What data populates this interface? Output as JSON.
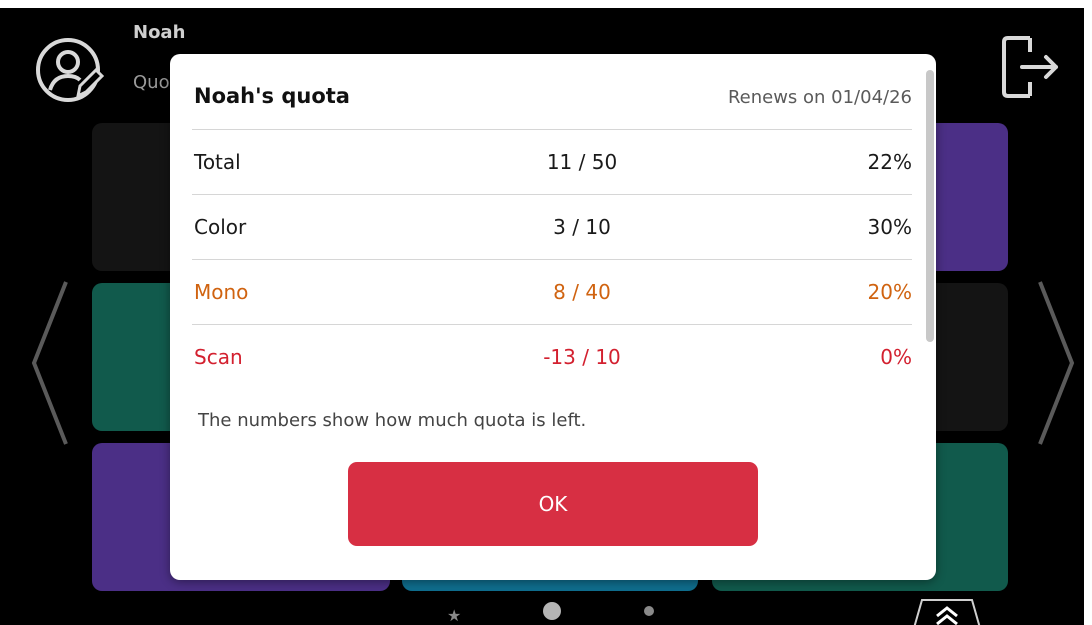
{
  "header": {
    "user_name": "Noah",
    "user_sub": "Quo",
    "avatar_icon": "user-edit-icon",
    "logout_icon": "logout-icon"
  },
  "tiles": {
    "colors": [
      "#141414",
      "#4b2f86",
      "#115a4c",
      "#141414",
      "#4b2f86",
      "#0f6e8e",
      "#115a4c"
    ]
  },
  "modal": {
    "title": "Noah's quota",
    "renew": "Renews on 01/04/26",
    "rows": [
      {
        "label": "Total",
        "value": "11 / 50",
        "percent": "22%"
      },
      {
        "label": "Color",
        "value": "3 / 10",
        "percent": "30%"
      },
      {
        "label": "Mono",
        "value": "8 / 40",
        "percent": "20%"
      },
      {
        "label": "Scan",
        "value": "-13 / 10",
        "percent": "0%"
      }
    ],
    "note": "The numbers show how much quota is left.",
    "ok_label": "OK",
    "colors": {
      "mono": "#d06310",
      "scan": "#d3202f",
      "ok": "#d72f43"
    }
  },
  "pagination": {
    "icons": [
      "star-icon",
      "dot-active",
      "dot"
    ],
    "up_icon": "chevron-up-double-icon"
  }
}
